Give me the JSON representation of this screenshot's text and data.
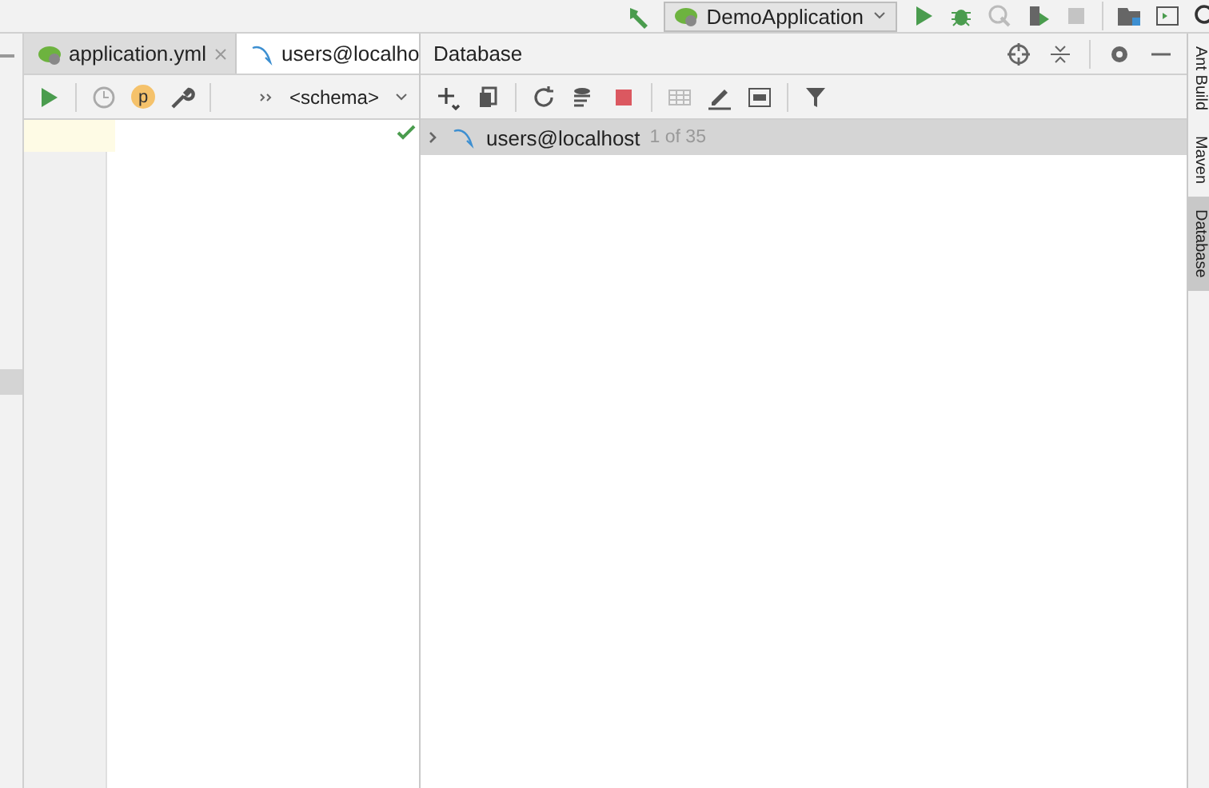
{
  "run_config": {
    "label": "DemoApplication"
  },
  "editor_tabs": [
    {
      "label": "application.yml",
      "selected": false
    },
    {
      "label": "users@localho",
      "selected": true
    }
  ],
  "editor_toolbar": {
    "session_badge": "p",
    "schema": "<schema>"
  },
  "database": {
    "title": "Database",
    "tree": [
      {
        "label": "users@localhost",
        "count": "1 of 35",
        "expanded": false,
        "selected": true
      }
    ]
  },
  "side_tabs": [
    {
      "label": "Ant Build",
      "selected": false
    },
    {
      "label": "Maven",
      "selected": false
    },
    {
      "label": "Database",
      "selected": true
    }
  ]
}
